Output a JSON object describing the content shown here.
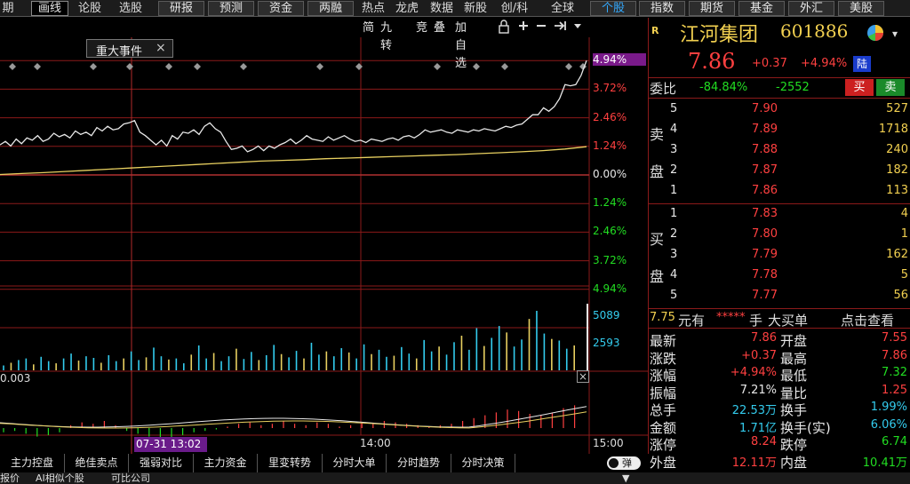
{
  "menu": {
    "plain": [
      {
        "id": "qi",
        "label": "期"
      },
      {
        "id": "lungu",
        "label": "论股"
      },
      {
        "id": "xuangu",
        "label": "选股"
      },
      {
        "id": "redian",
        "label": "热点"
      },
      {
        "id": "longhu",
        "label": "龙虎"
      },
      {
        "id": "shuju",
        "label": "数据"
      },
      {
        "id": "xingu",
        "label": "新股"
      },
      {
        "id": "chuangke",
        "label": "创/科"
      },
      {
        "id": "quanqiu",
        "label": "全球"
      }
    ],
    "huaxian": "画线",
    "buttons": [
      {
        "id": "yanbao",
        "label": "研报",
        "blue": false
      },
      {
        "id": "yuce",
        "label": "预测",
        "blue": false
      },
      {
        "id": "zijin",
        "label": "资金",
        "blue": false
      },
      {
        "id": "liangrong",
        "label": "两融",
        "blue": false
      },
      {
        "id": "gegu",
        "label": "个股",
        "blue": true
      },
      {
        "id": "zhishu",
        "label": "指数",
        "blue": false
      },
      {
        "id": "qihuo",
        "label": "期货",
        "blue": false
      },
      {
        "id": "jijin",
        "label": "基金",
        "blue": false
      },
      {
        "id": "waihui",
        "label": "外汇",
        "blue": false
      },
      {
        "id": "meigu",
        "label": "美股",
        "blue": false
      }
    ]
  },
  "chart_toolbar": {
    "jian": "简",
    "jiuzhuan": "九转",
    "jing": "竞",
    "die": "叠",
    "jiazixuan": "加自选",
    "lock_icon": "lock-icon",
    "plus_icon": "plus-icon",
    "minus_icon": "minus-icon",
    "expand_icon": "expand-icon",
    "dropdown_icon": "dropdown-icon"
  },
  "event_box": {
    "label": "重大事件",
    "close": "×"
  },
  "percent_labels": {
    "upper": [
      "4.94%",
      "3.72%",
      "2.46%",
      "1.24%",
      "0.00%",
      "1.24%",
      "2.46%",
      "3.72%",
      "4.94%"
    ],
    "colors": [
      "red",
      "red",
      "red",
      "red",
      "white",
      "green",
      "green",
      "green",
      "green"
    ]
  },
  "volume_labels": [
    "5089",
    "2593"
  ],
  "macd": {
    "value": "0.003",
    "close": "×"
  },
  "time_axis": {
    "cursor": "07-31 13:02",
    "mid": "14:00",
    "end": "15:00"
  },
  "chart_data": {
    "type": "line",
    "title": "",
    "xlabel": "",
    "ylabel": "",
    "ylim_pct": [
      -4.94,
      4.94
    ],
    "price_line_pct": [
      1.3,
      1.45,
      1.25,
      1.55,
      1.35,
      1.6,
      1.5,
      1.7,
      1.45,
      1.55,
      1.8,
      1.65,
      1.75,
      1.6,
      1.9,
      1.75,
      1.85,
      1.7,
      2.05,
      1.9,
      2.1,
      1.95,
      2.0,
      2.2,
      2.25,
      2.35,
      1.85,
      1.7,
      1.5,
      1.3,
      1.5,
      1.25,
      1.7,
      1.55,
      1.85,
      1.8,
      1.95,
      1.75,
      2.1,
      2.25,
      2.0,
      1.85,
      1.45,
      1.1,
      1.15,
      1.25,
      1.0,
      1.1,
      1.25,
      1.05,
      1.25,
      1.15,
      1.3,
      1.4,
      1.55,
      1.35,
      1.5,
      1.7,
      1.55,
      1.5,
      1.45,
      1.65,
      1.5,
      1.6,
      1.7,
      1.55,
      1.45,
      1.5,
      1.4,
      1.55,
      1.5,
      1.45,
      1.55,
      1.6,
      1.5,
      1.65,
      1.7,
      1.6,
      1.75,
      1.95,
      1.85,
      1.9,
      1.95,
      1.85,
      1.8,
      1.95,
      1.9,
      1.85,
      1.95,
      1.9,
      2.0,
      1.95,
      1.9,
      2.0,
      2.1,
      2.05,
      2.15,
      2.2,
      2.4,
      2.6,
      2.6,
      2.9,
      2.75,
      2.95,
      3.3,
      3.9,
      3.85,
      3.9,
      4.3,
      4.94
    ],
    "avg_line_pct": [
      0.02,
      0.06,
      0.1,
      0.15,
      0.2,
      0.25,
      0.3,
      0.35,
      0.4,
      0.45,
      0.5,
      0.55,
      0.6,
      0.63,
      0.66,
      0.7,
      0.73,
      0.76,
      0.79,
      0.82,
      0.85,
      0.88,
      0.92,
      0.96,
      1.0,
      1.05,
      1.12,
      1.22
    ],
    "volume": [
      9,
      14,
      19,
      22,
      11,
      25,
      17,
      13,
      22,
      31,
      18,
      26,
      23,
      14,
      28,
      17,
      22,
      35,
      19,
      24,
      42,
      26,
      20,
      22,
      13,
      29,
      46,
      22,
      32,
      17,
      26,
      40,
      21,
      34,
      19,
      28,
      47,
      30,
      24,
      36,
      22,
      51,
      29,
      35,
      26,
      41,
      33,
      22,
      48,
      30,
      38,
      25,
      27,
      43,
      31,
      22,
      56,
      35,
      44,
      29,
      52,
      64,
      38,
      78,
      45,
      60,
      82,
      70,
      44,
      57,
      95,
      110,
      68,
      58,
      55,
      40,
      46
    ],
    "macd_diff": [
      -3,
      -2,
      -4,
      -6,
      -5,
      -3,
      2,
      4,
      3,
      5,
      2,
      -2,
      -4,
      -6,
      -8,
      -7,
      -5,
      -3,
      -2,
      -1,
      1,
      3,
      4,
      2,
      3,
      5,
      3,
      2,
      4,
      3,
      1,
      2,
      4,
      3,
      5,
      4,
      3,
      2,
      1,
      2,
      3,
      5,
      7,
      9,
      11,
      13,
      12,
      10,
      9,
      11,
      14,
      16
    ]
  },
  "stock": {
    "tag": "R",
    "name": "江河集团",
    "code": "601886",
    "price": "7.86",
    "change": "+0.37",
    "pct": "+4.94%",
    "market": "陆"
  },
  "weibi": {
    "label": "委比",
    "ratio": "-84.84%",
    "diff": "-2552",
    "buy": "买",
    "sell": "卖"
  },
  "sell_side": {
    "side1": "卖",
    "side2": "盘",
    "orders": [
      {
        "level": "5",
        "price": "7.90",
        "vol": "527"
      },
      {
        "level": "4",
        "price": "7.89",
        "vol": "1718"
      },
      {
        "level": "3",
        "price": "7.88",
        "vol": "240"
      },
      {
        "level": "2",
        "price": "7.87",
        "vol": "182"
      },
      {
        "level": "1",
        "price": "7.86",
        "vol": "113"
      }
    ]
  },
  "buy_side": {
    "side1": "买",
    "side2": "盘",
    "orders": [
      {
        "level": "1",
        "price": "7.83",
        "vol": "4"
      },
      {
        "level": "2",
        "price": "7.80",
        "vol": "1"
      },
      {
        "level": "3",
        "price": "7.79",
        "vol": "162"
      },
      {
        "level": "4",
        "price": "7.78",
        "vol": "5"
      },
      {
        "level": "5",
        "price": "7.77",
        "vol": "56"
      }
    ]
  },
  "big_order": {
    "price": "7.75",
    "unit": "元有",
    "stars": "*****",
    "hand": "手",
    "label": "大买单",
    "action": "点击查看"
  },
  "quote_stats": [
    {
      "l": "最新",
      "v": "7.86",
      "vc": "red",
      "l2": "开盘",
      "v2": "7.55",
      "v2c": "red"
    },
    {
      "l": "涨跌",
      "v": "+0.37",
      "vc": "red",
      "l2": "最高",
      "v2": "7.86",
      "v2c": "red"
    },
    {
      "l": "涨幅",
      "v": "+4.94%",
      "vc": "red",
      "l2": "最低",
      "v2": "7.32",
      "v2c": "green"
    },
    {
      "l": "振幅",
      "v": "7.21%",
      "vc": "white",
      "l2": "量比",
      "v2": "1.25",
      "v2c": "red"
    },
    {
      "l": "总手",
      "v": "22.53万",
      "vc": "cyan",
      "l2": "换手",
      "v2": "1.99%",
      "v2c": "cyan"
    },
    {
      "l": "金额",
      "v": "1.71亿",
      "vc": "cyan",
      "l2": "换手(实)",
      "v2": "6.06%",
      "v2c": "cyan"
    },
    {
      "l": "涨停",
      "v": "8.24",
      "vc": "red",
      "l2": "跌停",
      "v2": "6.74",
      "v2c": "green"
    },
    {
      "l": "外盘",
      "v": "12.11万",
      "vc": "red",
      "l2": "内盘",
      "v2": "10.41万",
      "v2c": "green"
    }
  ],
  "bottom_tabs": [
    "主力控盘",
    "绝佳卖点",
    "强弱对比",
    "主力资金",
    "里变转势",
    "分时大单",
    "分时趋势",
    "分时决策"
  ],
  "toggle_label": "弹",
  "status_tabs": [
    "报价",
    "AI相似个股",
    "可比公司"
  ],
  "colors": {
    "red": "#ff4040",
    "green": "#22dd22",
    "grid": "#8b1a1a",
    "price": "#e8e8e8",
    "avg": "#e8d060"
  }
}
